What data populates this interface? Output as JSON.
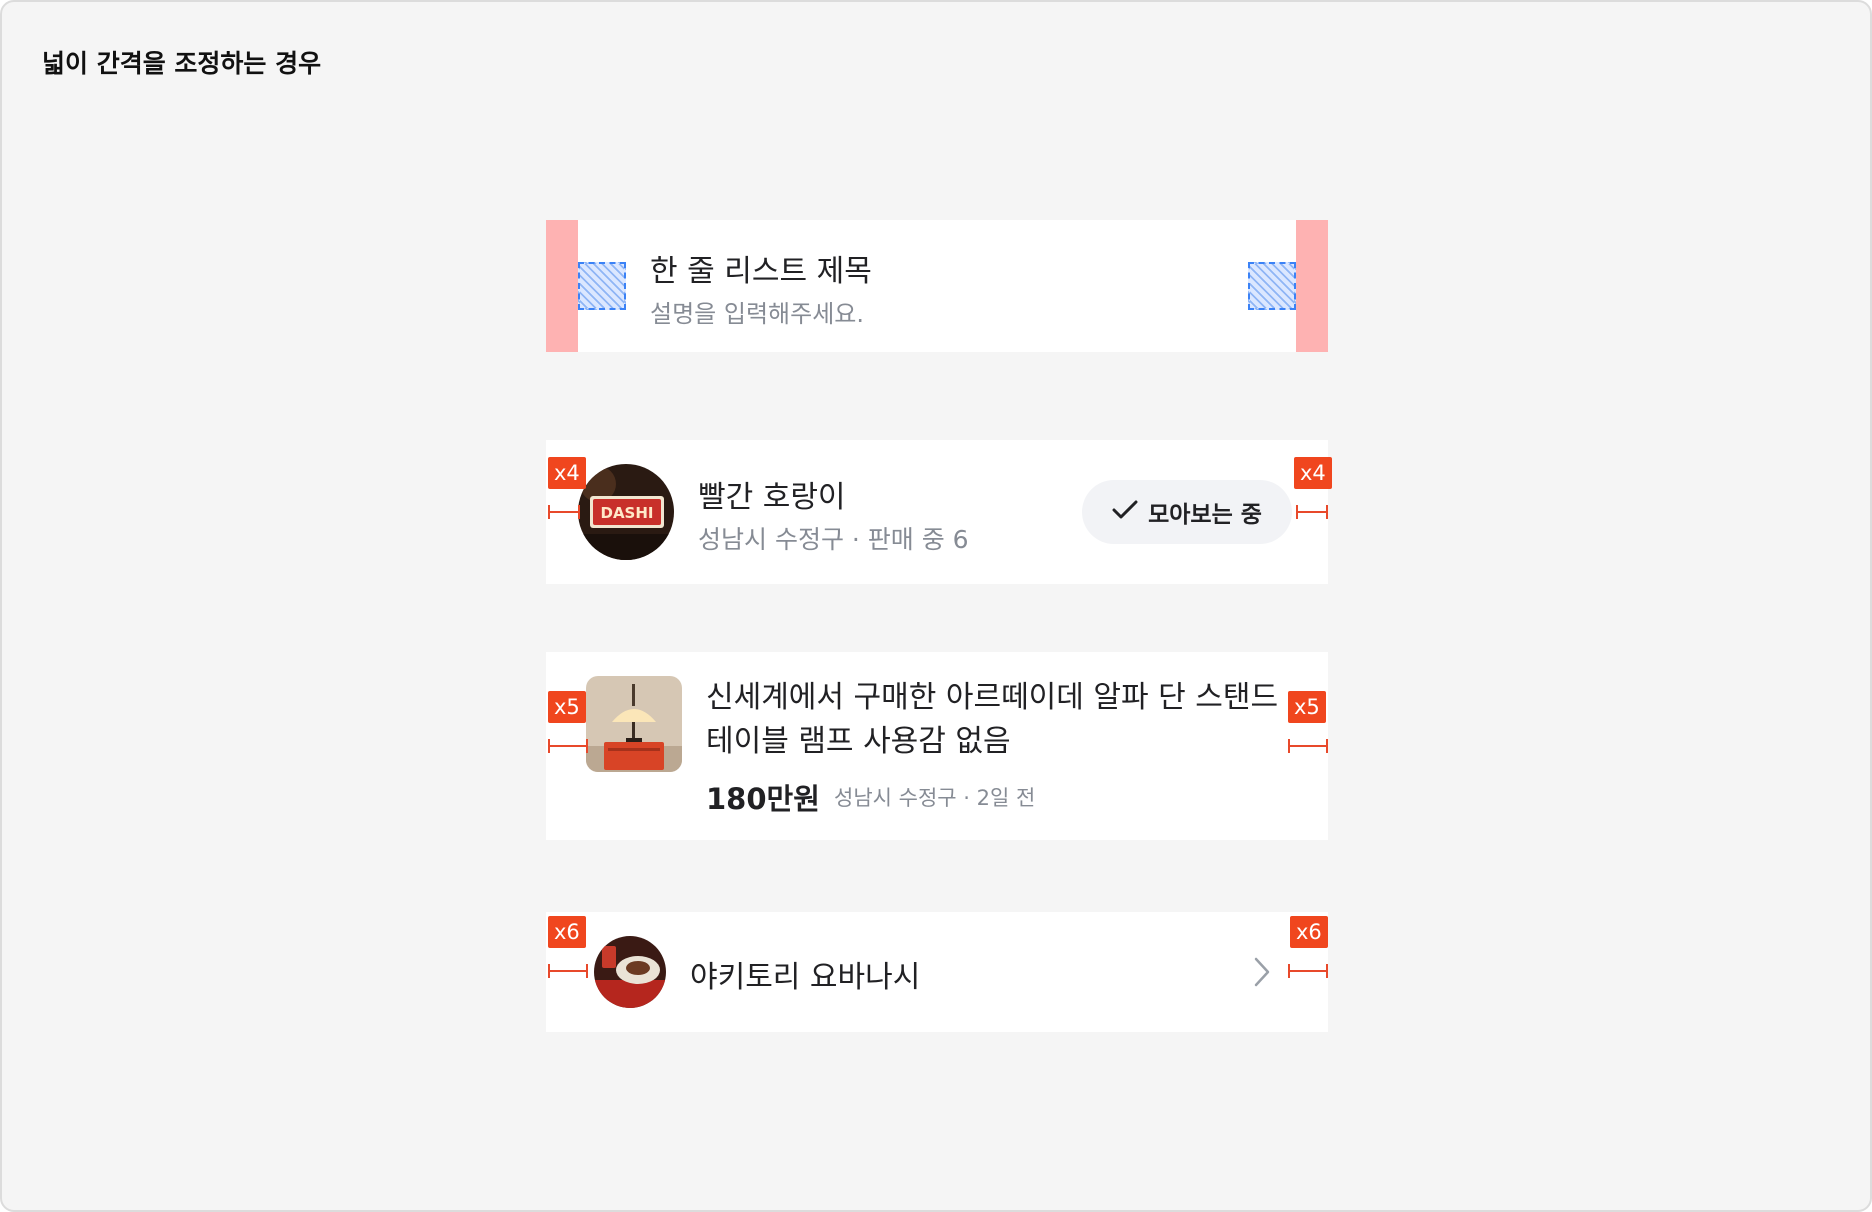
{
  "page": {
    "title": "넓이 간격을 조정하는 경우"
  },
  "card1": {
    "title": "한 줄 리스트 제목",
    "description": "설명을 입력해주세요."
  },
  "card2": {
    "spacing_label": "x4",
    "title": "빨간 호랑이",
    "subtitle": "성남시 수정구 · 판매 중 6",
    "button_label": "모아보는 중",
    "avatar_sign_text": "DASHI"
  },
  "card3": {
    "spacing_label": "x5",
    "title": "신세계에서 구매한 아르떼이데 알파 단 스탠드 테이블 램프 사용감 없음",
    "price": "180만원",
    "meta": "성남시 수정구 · 2일 전"
  },
  "card4": {
    "spacing_label": "x6",
    "title": "야키토리 요바나시"
  },
  "colors": {
    "accent": "#f0461e",
    "padding_highlight": "#feb2b2",
    "placeholder_outline": "#3b82f6",
    "secondary_text": "#868b94",
    "background": "#f5f5f5"
  },
  "icons": [
    "checkmark-icon",
    "chevron-right-icon"
  ]
}
